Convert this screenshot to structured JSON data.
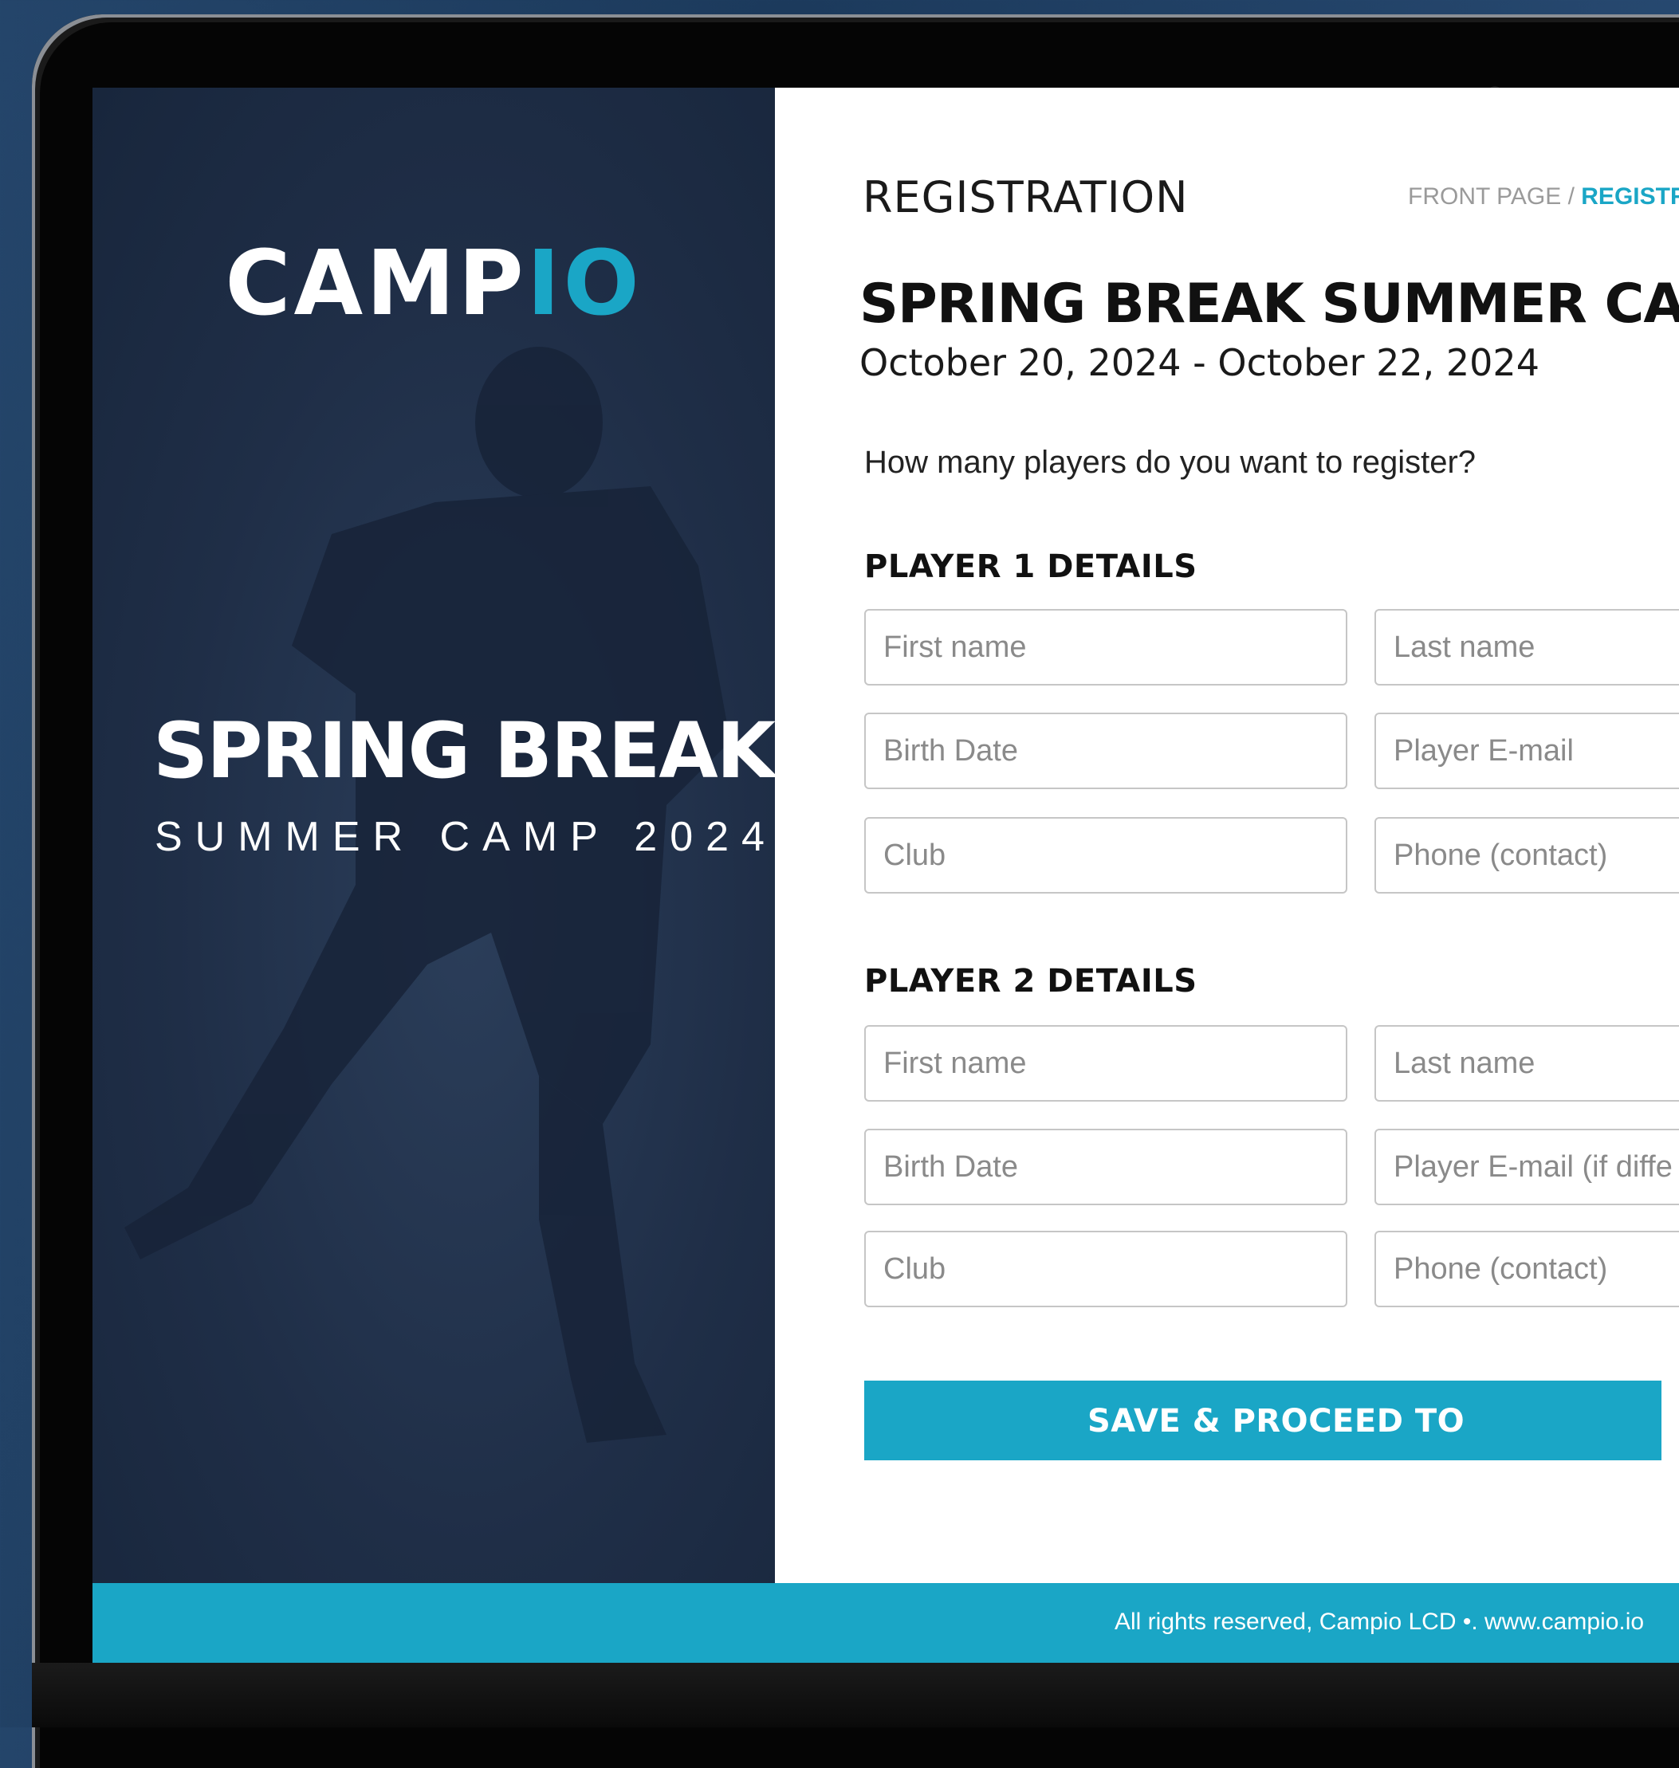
{
  "brand": {
    "logo_part1": "CAMP",
    "logo_part2": "IO",
    "accent": "#1aa6c6",
    "dark_panel": "#1f2e47"
  },
  "hero": {
    "title": "SPRING BREAK",
    "subtitle": "SUMMER CAMP 2024"
  },
  "header": {
    "heading": "REGISTRATION",
    "breadcrumb": {
      "home": "FRONT PAGE",
      "separator": " / ",
      "current": "REGISTRA"
    }
  },
  "camp": {
    "title": "SPRING BREAK SUMMER CAMP",
    "dates": "October 20, 2024 - October 22, 2024"
  },
  "question": "How many players do you want to register?",
  "players": [
    {
      "section_title": "PLAYER 1 DETAILS",
      "first_name": "First name",
      "last_name": "Last name",
      "birth_date": "Birth Date",
      "email": "Player E-mail",
      "club": "Club",
      "phone": "Phone (contact)"
    },
    {
      "section_title": "PLAYER 2 DETAILS",
      "first_name": "First name",
      "last_name": "Last name",
      "birth_date": "Birth Date",
      "email": "Player E-mail (if diffe",
      "club": "Club",
      "phone": "Phone (contact)"
    }
  ],
  "cta_label": "SAVE & PROCEED TO CHECKOUT",
  "footer_text": "All rights reserved, Campio LCD •. www.campio.io"
}
